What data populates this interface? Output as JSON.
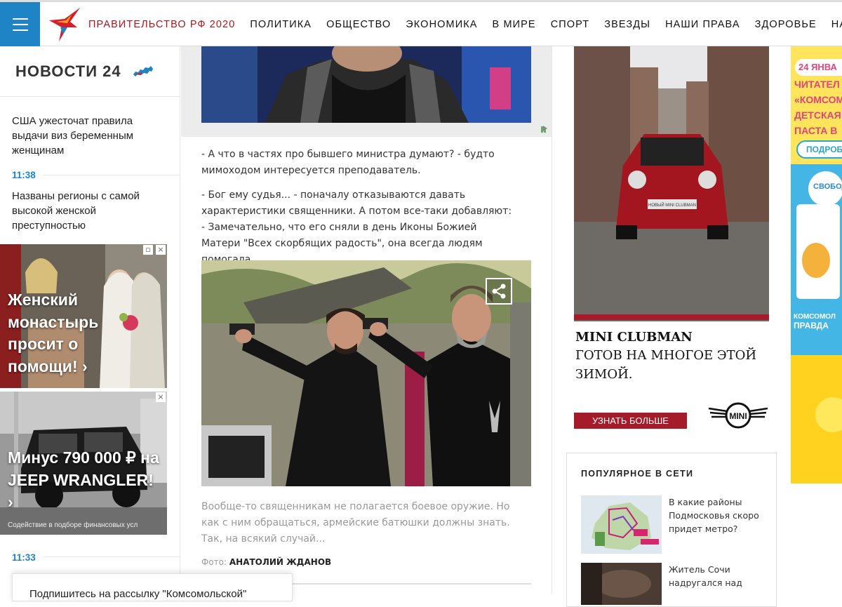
{
  "nav": {
    "items": [
      "ПРАВИТЕЛЬСТВО РФ 2020",
      "ПОЛИТИКА",
      "ОБЩЕСТВО",
      "ЭКОНОМИКА",
      "В МИРЕ",
      "СПОРТ",
      "ЗВЕЗДЫ",
      "НАШИ ПРАВА",
      "ЗДОРОВЬЕ",
      "НАУ"
    ]
  },
  "news": {
    "title": "НОВОСТИ 24",
    "items": [
      {
        "text": "США ужесточат правила выдачи виз беременным женщинам"
      },
      {
        "time": "11:38",
        "text": "Названы регионы с самой высокой женской преступностью"
      },
      {
        "time": "11:33"
      }
    ]
  },
  "ads": {
    "monastery": "Женский монастырь просит о помощи! ›",
    "jeep": "Минус 790 000 ₽ на JEEP WRANGLER! ›",
    "jeep_sub": "Содействие в подборе финансовых усл",
    "close": "×",
    "min": "▫"
  },
  "article": {
    "para1": "- А что в частях про бывшего министра думают? - будто мимоходом интересуется преподаватель.",
    "para2": "- Бог ему судья... - поначалу отказываются давать характеристики священники. А потом все-таки добавляют: - Замечательно, что его сняли в день Иконы Божией Матери \"Всех скорбящих радость\", она всегда людям помогала.",
    "caption": "Вообще-то священникам не полагается боевое оружие. Но как с ним обращаться, армейские батюшки должны знать. Так, на всякий случай...",
    "credit_label": "Фото:",
    "credit_name": "АНАТОЛИЙ ЖДАНОВ",
    "plate": "НОВЫЙ MINI CLUBMAN"
  },
  "mini_ad": {
    "title": "MINI CLUBMAN",
    "subtitle": "ГОТОВ НА МНОГОЕ ЭТОЙ ЗИМОЙ.",
    "button": "УЗНАТЬ БОЛЬШЕ",
    "logo": "MINI"
  },
  "popular": {
    "title": "ПОПУЛЯРНОЕ В СЕТИ",
    "items": [
      {
        "text": "В какие районы Подмосковья скоро придет метро?"
      },
      {
        "text": "Житель Сочи надругался над"
      }
    ]
  },
  "side_ad": {
    "date": "24 ЯНВА",
    "lines": [
      "ЧИТАТЕЛ",
      "«КОМСОМ",
      "ДЕТСКАЯ",
      "ПАСТА В"
    ],
    "button": "ПОДРОБ",
    "brand1": "СВОБОД",
    "brand2": "КОМСОМОЛ",
    "brand3": "ПРАВДА"
  },
  "subscribe": {
    "text": "Подпишитесь на рассылку \"Комсомольской\""
  },
  "colors": {
    "accent_blue": "#1e84c6",
    "nav_red": "#b0141b",
    "mini_red": "#a51b2a"
  }
}
